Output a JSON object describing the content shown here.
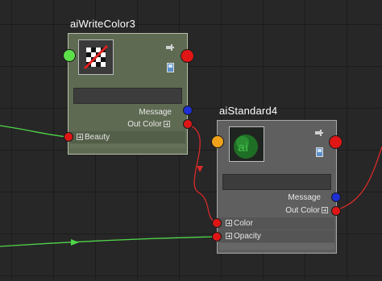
{
  "colors": {
    "port_red": "#e01616",
    "port_green": "#5ce04a",
    "port_blue": "#1e2fd6",
    "port_orange": "#f0a21a",
    "wire_green": "#4fd64a",
    "wire_red": "#d82a2a",
    "write_node_bg": "#5e6a52",
    "std_node_bg": "#5f5f5f"
  },
  "nodes": {
    "write": {
      "title": "aiWriteColor3",
      "thumbnail_icon": "checker-slash-icon",
      "pin_icon": "pin-icon",
      "swatch_icon": "swatch-icon",
      "rows": {
        "message": "Message",
        "out_color": "Out Color",
        "beauty": "Beauty"
      }
    },
    "std": {
      "title": "aiStandard4",
      "thumbnail_icon": "sphere-ai-icon",
      "pin_icon": "pin-icon",
      "swatch_icon": "swatch-icon",
      "rows": {
        "message": "Message",
        "out_color": "Out Color",
        "color": "Color",
        "opacity": "Opacity"
      }
    }
  }
}
